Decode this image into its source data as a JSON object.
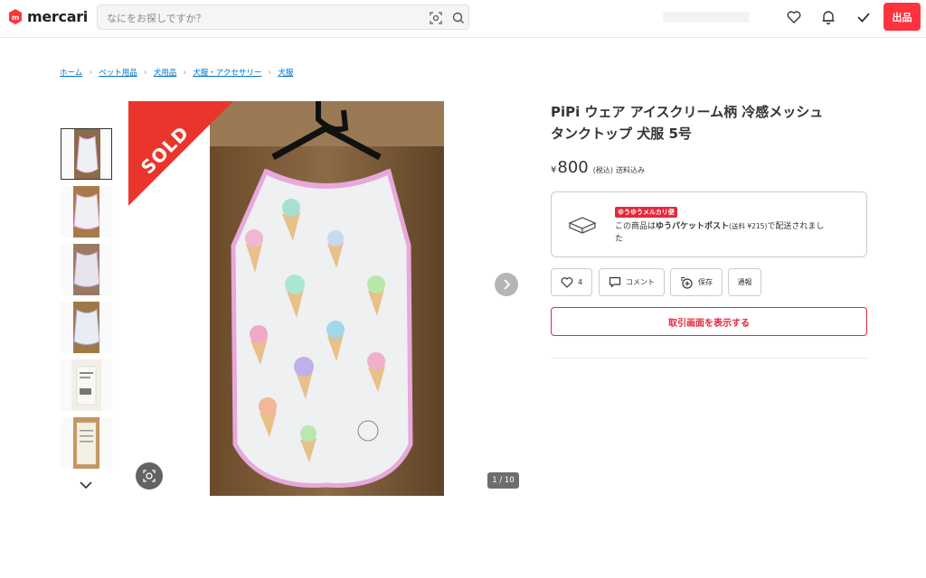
{
  "header": {
    "logo_text": "mercari",
    "search_placeholder": "なにをお探しですか？",
    "sell_label": "出品"
  },
  "breadcrumb": [
    "ホーム",
    "ペット用品",
    "犬用品",
    "犬服・アクセサリー",
    "犬服"
  ],
  "gallery": {
    "sold_label": "SOLD",
    "counter": "1 / 10"
  },
  "item": {
    "title_line1": "PiPi ウェア アイスクリーム柄 冷感メッシュ",
    "title_line2": "タンクトップ 犬服 5号",
    "currency": "¥",
    "price": "800",
    "tax_label": "(税込)",
    "shipping_label": "送料込み"
  },
  "shipping": {
    "badge": "ゆうゆうメルカリ便",
    "text_pre": "この商品は",
    "method": "ゆうパケットポスト",
    "fee": "(送料 ¥215)",
    "text_post": "で配送されまし",
    "text_line2": "た"
  },
  "actions": {
    "like_count": "4",
    "comment_label": "コメント",
    "save_label": "保存",
    "report_label": "通報"
  },
  "trade_button": "取引画面を表示する",
  "colors": {
    "accent": "#ea352d",
    "link": "#0073cc"
  }
}
